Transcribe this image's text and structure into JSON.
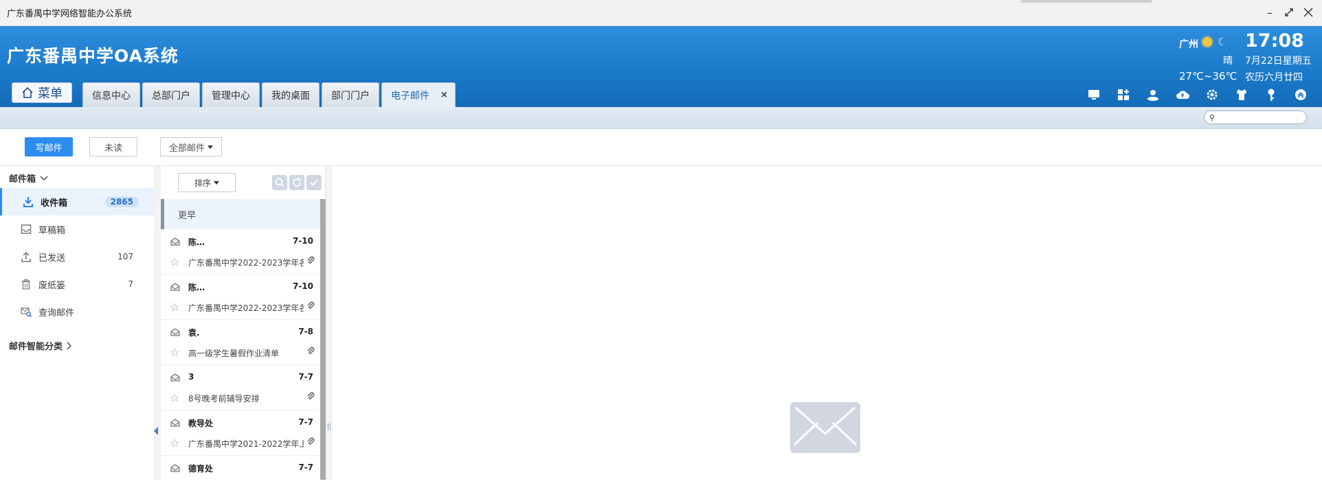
{
  "window": {
    "title": "广东番禺中学网络智能办公系统"
  },
  "header": {
    "app_title": "广东番禺中学OA系统",
    "menu_label": "菜单",
    "weather": {
      "city": "广州",
      "condition": "晴",
      "temperature": "27℃~36℃",
      "time": "17:08",
      "date": "7月22日星期五",
      "lunar": "农历六月廿四"
    },
    "tabs": [
      {
        "label": "信息中心"
      },
      {
        "label": "总部门户"
      },
      {
        "label": "管理中心"
      },
      {
        "label": "我的桌面"
      },
      {
        "label": "部门门户"
      },
      {
        "label": "电子邮件",
        "close": "×"
      }
    ],
    "icons": [
      "monitor-icon",
      "apps-icon",
      "user-icon",
      "cloud-icon",
      "gear-icon",
      "shirt-icon",
      "key-icon",
      "collapse-icon"
    ]
  },
  "toolbar": {
    "compose_label": "写邮件",
    "unread_label": "未读",
    "filter_label": "全部邮件"
  },
  "sidebar": {
    "mailbox_header": "邮件箱",
    "items": [
      {
        "label": "收件箱",
        "count": "2865"
      },
      {
        "label": "草稿箱",
        "count": ""
      },
      {
        "label": "已发送",
        "count": "107"
      },
      {
        "label": "废纸篓",
        "count": "7"
      },
      {
        "label": "查询邮件",
        "count": ""
      }
    ],
    "smart_header": "邮件智能分类"
  },
  "list": {
    "sort_label": "排序",
    "group_label": "更早",
    "mails": [
      {
        "from": "陈…",
        "date": "7-10",
        "subject": "广东番禺中学2022-2023学年各"
      },
      {
        "from": "陈…",
        "date": "7-10",
        "subject": "广东番禺中学2022-2023学年各"
      },
      {
        "from": "袁.",
        "date": "7-8",
        "subject": "高一级学生暑假作业清单"
      },
      {
        "from": "3",
        "date": "7-7",
        "subject": "8号晚考前辅导安排"
      },
      {
        "from": "教导处",
        "date": "7-7",
        "subject": "广东番禺中学2021-2022学年上"
      },
      {
        "from": "德育处",
        "date": "7-7",
        "subject": ""
      }
    ]
  },
  "colors": {
    "header_blue": "#1a79c9",
    "accent": "#2d8cf0"
  }
}
